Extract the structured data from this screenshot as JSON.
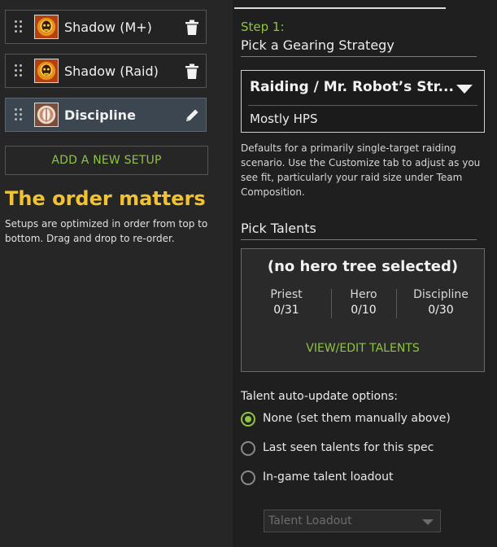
{
  "setups": [
    {
      "label": "Shadow (M+)",
      "icon": "shadow-spec-icon",
      "action_icon": "trash-icon"
    },
    {
      "label": "Shadow (Raid)",
      "icon": "shadow-spec-icon",
      "action_icon": "trash-icon"
    },
    {
      "label": "Discipline",
      "icon": "discipline-spec-icon",
      "action_icon": "pencil-icon"
    }
  ],
  "add_setup_label": "ADD A NEW SETUP",
  "order_title": "The order matters",
  "order_desc": "Setups are optimized in order from top to bottom. Drag and drop to re-order.",
  "step_label": "Step 1:",
  "gearing": {
    "title": "Pick a Gearing Strategy",
    "strategy_name": "Raiding / Mr. Robot’s Str...",
    "strategy_sub": "Mostly HPS",
    "description": "Defaults for a primarily single-target raiding scenario. Use the Customize tab to adjust as you see fit, particularly your raid size under Team Composition."
  },
  "talents": {
    "title": "Pick Talents",
    "hero_tree": "(no hero tree selected)",
    "columns": [
      {
        "name": "Priest",
        "value": "0/31"
      },
      {
        "name": "Hero",
        "value": "0/10"
      },
      {
        "name": "Discipline",
        "value": "0/30"
      }
    ],
    "view_edit_label": "VIEW/EDIT TALENTS"
  },
  "auto_update": {
    "label": "Talent auto-update options:",
    "options": [
      {
        "label": "None (set them manually above)",
        "selected": true
      },
      {
        "label": "Last seen talents for this spec",
        "selected": false
      },
      {
        "label": "In-game talent loadout",
        "selected": false
      }
    ],
    "loadout_placeholder": "Talent Loadout"
  },
  "colors": {
    "accent_green": "#8fc440",
    "accent_gold": "#f2c230",
    "active_row": "#3c4650"
  }
}
